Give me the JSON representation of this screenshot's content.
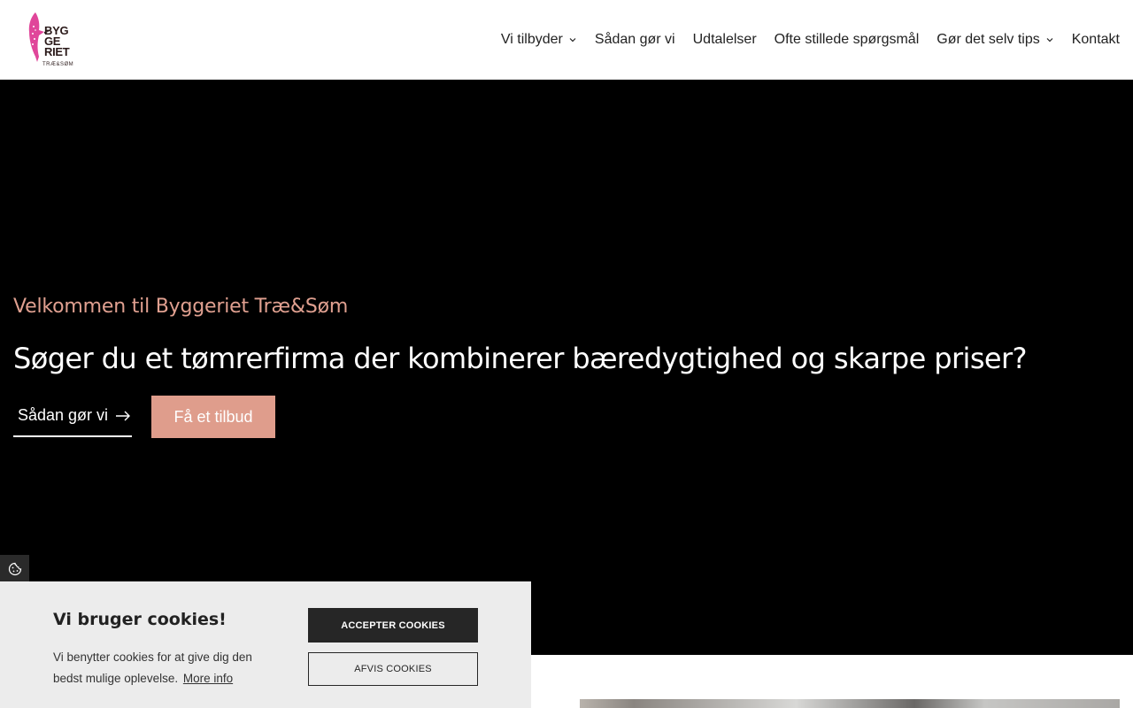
{
  "brand": {
    "logo_lines": [
      "BYG",
      "GE",
      "RIET"
    ],
    "logo_sub": "TRÆ&SØM",
    "logo_icon": "woodpecker-icon",
    "accent_color": "#df9d8c",
    "logo_pink": "#e0469a"
  },
  "nav": {
    "items": [
      {
        "label": "Vi tilbyder",
        "has_dropdown": true
      },
      {
        "label": "Sådan gør vi",
        "has_dropdown": false
      },
      {
        "label": "Udtalelser",
        "has_dropdown": false
      },
      {
        "label": "Ofte stillede spørgsmål",
        "has_dropdown": false
      },
      {
        "label": "Gør det selv tips",
        "has_dropdown": true
      },
      {
        "label": "Kontakt",
        "has_dropdown": false
      }
    ]
  },
  "hero": {
    "kicker": "Velkommen til Byggeriet Træ&Søm",
    "title": "Søger du et tømrerfirma der kombinerer bæredygtighed og skarpe priser?",
    "link_label": "Sådan gør vi",
    "cta_label": "Få et tilbud"
  },
  "cookies": {
    "title": "Vi bruger cookies!",
    "text": "Vi benytter cookies for at give dig den bedst mulige oplevelse.",
    "more_info": "More info",
    "accept_label": "ACCEPTER COOKIES",
    "decline_label": "AFVIS COOKIES",
    "tab_icon": "cookie-icon"
  }
}
